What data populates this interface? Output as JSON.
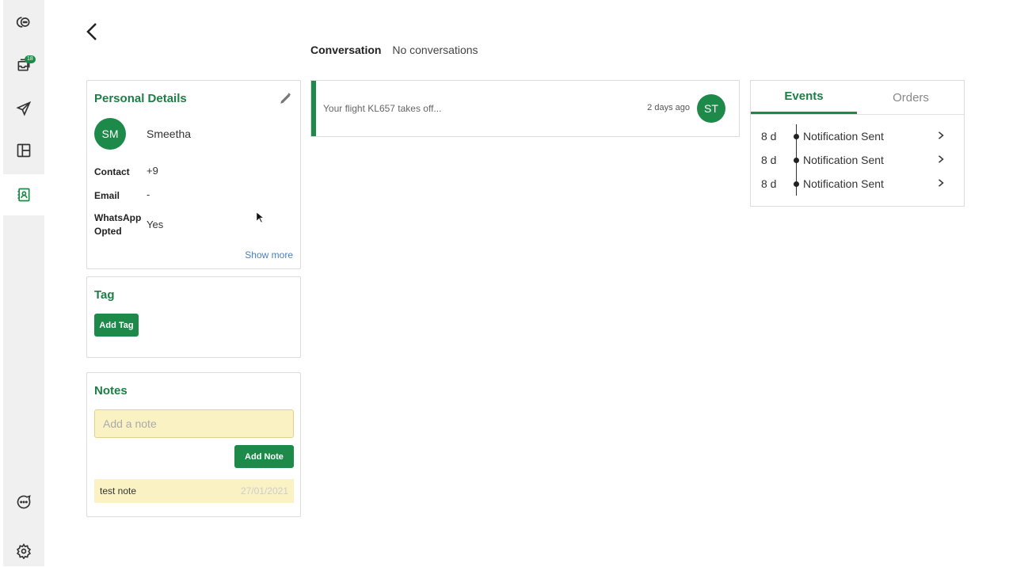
{
  "sidebar": {
    "badge_count": "18",
    "icons": [
      "chat-bubble-icon",
      "inbox-icon",
      "send-icon",
      "layout-icon",
      "contact-card-icon",
      "message-icon",
      "settings-icon"
    ]
  },
  "conversation": {
    "label": "Conversation",
    "status": "No conversations",
    "item": {
      "text": "Your flight KL657 takes off...",
      "time": "2 days ago",
      "avatar": "ST"
    }
  },
  "personal_details": {
    "title": "Personal Details",
    "avatar": "SM",
    "name": "Smeetha",
    "contact_label": "Contact",
    "contact_value": "+9",
    "email_label": "Email",
    "email_value": "-",
    "whatsapp_label": "WhatsApp Opted",
    "whatsapp_value": "Yes",
    "show_more": "Show more"
  },
  "tag": {
    "title": "Tag",
    "add_button": "Add Tag"
  },
  "notes": {
    "title": "Notes",
    "input_placeholder": "Add a note",
    "add_button": "Add Note",
    "items": [
      {
        "text": "test note",
        "date": "27/01/2021"
      }
    ]
  },
  "events": {
    "tabs": [
      {
        "label": "Events",
        "active": true
      },
      {
        "label": "Orders",
        "active": false
      }
    ],
    "items": [
      {
        "age": "8 d",
        "name": "Notification Sent"
      },
      {
        "age": "8 d",
        "name": "Notification Sent"
      },
      {
        "age": "8 d",
        "name": "Notification Sent"
      }
    ]
  },
  "colors": {
    "accent": "#1e8a4a",
    "note_bg": "#fbf2c4"
  }
}
